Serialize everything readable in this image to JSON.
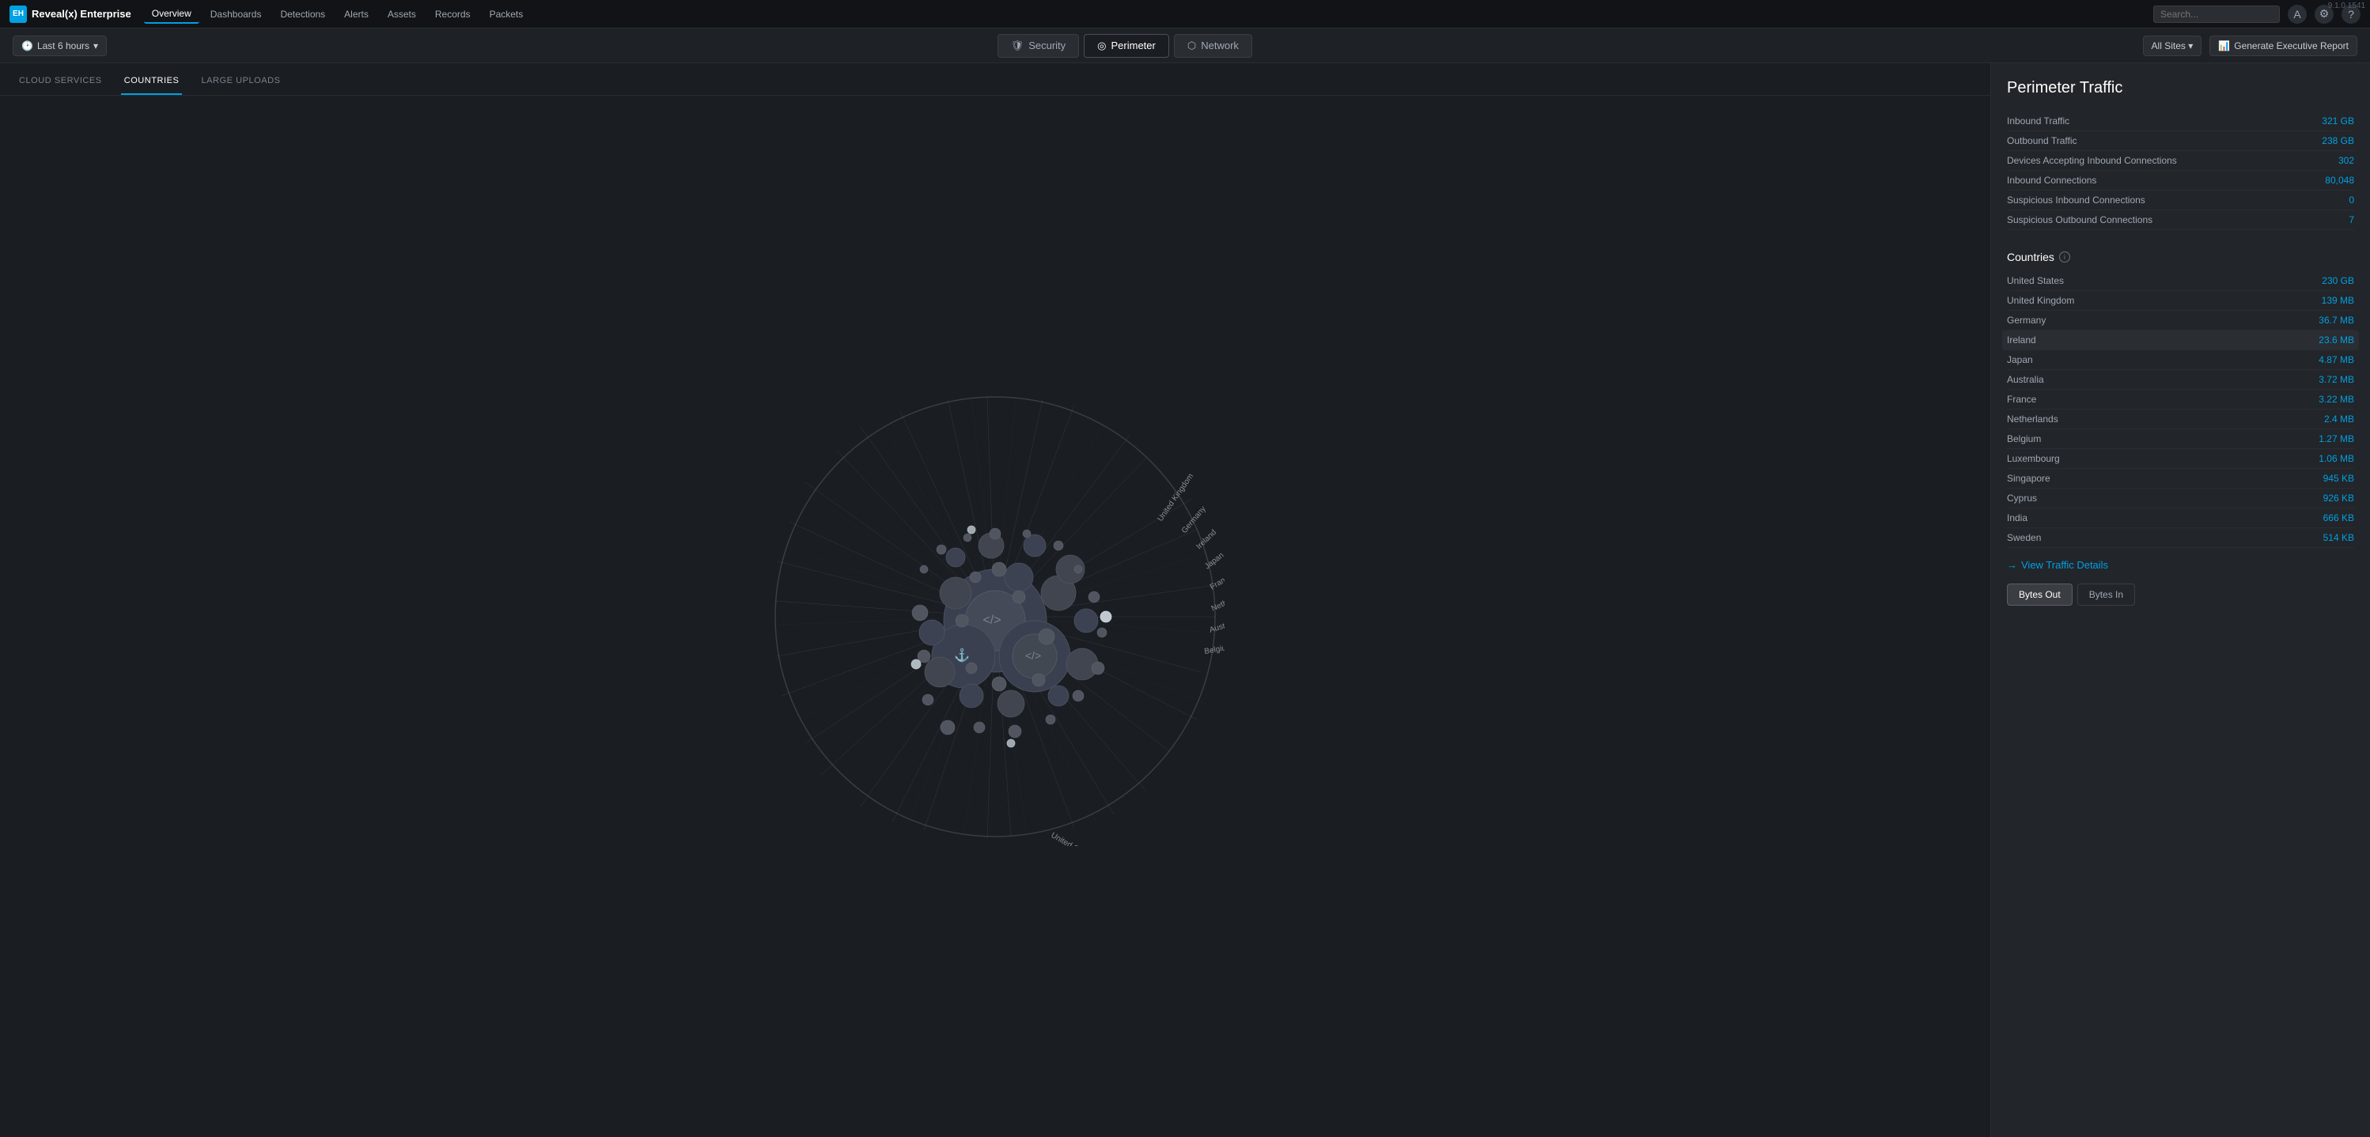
{
  "app": {
    "logo_text": "ExtraHop",
    "product_name": "Reveal(x) Enterprise",
    "version": "9.1.0\n1541"
  },
  "top_nav": {
    "links": [
      {
        "id": "overview",
        "label": "Overview",
        "active": true
      },
      {
        "id": "dashboards",
        "label": "Dashboards",
        "active": false
      },
      {
        "id": "detections",
        "label": "Detections",
        "active": false
      },
      {
        "id": "alerts",
        "label": "Alerts",
        "active": false
      },
      {
        "id": "assets",
        "label": "Assets",
        "active": false
      },
      {
        "id": "records",
        "label": "Records",
        "active": false
      },
      {
        "id": "packets",
        "label": "Packets",
        "active": false
      }
    ],
    "search_placeholder": "Search...",
    "icons": [
      "user",
      "settings",
      "help"
    ]
  },
  "sec_nav": {
    "time_label": "Last 6 hours",
    "panels": [
      {
        "id": "security",
        "label": "Security",
        "icon": "shield",
        "active": false
      },
      {
        "id": "perimeter",
        "label": "Perimeter",
        "icon": "target",
        "active": true
      },
      {
        "id": "network",
        "label": "Network",
        "icon": "network",
        "active": false
      }
    ],
    "sites_label": "All Sites",
    "report_label": "Generate Executive Report"
  },
  "tabs": [
    {
      "id": "cloud-services",
      "label": "CLOUD SERVICES",
      "active": false
    },
    {
      "id": "countries",
      "label": "COUNTRIES",
      "active": true
    },
    {
      "id": "large-uploads",
      "label": "LARGE UPLOADS",
      "active": false
    }
  ],
  "right_panel": {
    "title": "Perimeter Traffic",
    "traffic_items": [
      {
        "label": "Inbound Traffic",
        "value": "321 GB"
      },
      {
        "label": "Outbound Traffic",
        "value": "238 GB"
      },
      {
        "label": "Devices Accepting Inbound Connections",
        "value": "302"
      },
      {
        "label": "Inbound Connections",
        "value": "80,048"
      },
      {
        "label": "Suspicious Inbound Connections",
        "value": "0"
      },
      {
        "label": "Suspicious Outbound Connections",
        "value": "7"
      }
    ],
    "countries_title": "Countries",
    "countries": [
      {
        "name": "United States",
        "value": "230 GB",
        "highlighted": false
      },
      {
        "name": "United Kingdom",
        "value": "139 MB",
        "highlighted": false
      },
      {
        "name": "Germany",
        "value": "36.7 MB",
        "highlighted": false
      },
      {
        "name": "Ireland",
        "value": "23.6 MB",
        "highlighted": true
      },
      {
        "name": "Japan",
        "value": "4.87 MB",
        "highlighted": false
      },
      {
        "name": "Australia",
        "value": "3.72 MB",
        "highlighted": false
      },
      {
        "name": "France",
        "value": "3.22 MB",
        "highlighted": false
      },
      {
        "name": "Netherlands",
        "value": "2.4 MB",
        "highlighted": false
      },
      {
        "name": "Belgium",
        "value": "1.27 MB",
        "highlighted": false
      },
      {
        "name": "Luxembourg",
        "value": "1.06 MB",
        "highlighted": false
      },
      {
        "name": "Singapore",
        "value": "945 KB",
        "highlighted": false
      },
      {
        "name": "Cyprus",
        "value": "926 KB",
        "highlighted": false
      },
      {
        "name": "India",
        "value": "666 KB",
        "highlighted": false
      },
      {
        "name": "Sweden",
        "value": "514 KB",
        "highlighted": false
      }
    ],
    "view_details_label": "View Traffic Details",
    "bytes_out_label": "Bytes Out",
    "bytes_in_label": "Bytes In",
    "active_toggle": "bytes-out"
  },
  "globe_labels": [
    {
      "text": "United Kingdom",
      "angle": -60
    },
    {
      "text": "Germany",
      "angle": -52
    },
    {
      "text": "Ireland",
      "angle": -45
    },
    {
      "text": "Japan",
      "angle": -38
    },
    {
      "text": "France",
      "angle": -31
    },
    {
      "text": "Netherlands",
      "angle": -24
    },
    {
      "text": "Australia",
      "angle": -17
    },
    {
      "text": "Belgium",
      "angle": -10
    },
    {
      "text": "United States",
      "angle": 30
    }
  ]
}
